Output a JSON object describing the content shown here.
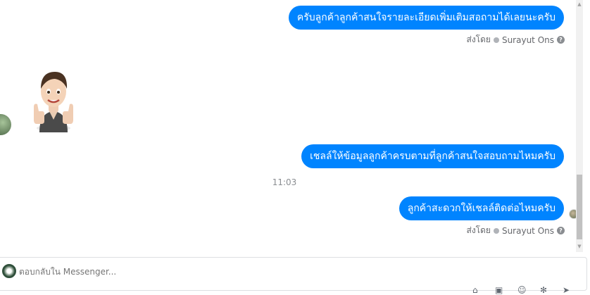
{
  "messages": [
    {
      "text": "ครับลูกค้าลูกค้าสนใจรายละเอียดเพิ่มเติมสอถามได้เลยนะครับ"
    },
    {
      "text": "เชลล์ให้ข้อมูลลูกค้าครบตามที่ลูกค้าสนใจสอบถามไหมครับ"
    },
    {
      "text": "ลูกค้าสะดวกให้เชลล์ติดต่อไหมครับ"
    }
  ],
  "sent_by": {
    "prefix": "ส่งโดย",
    "name": "Surayut Ons",
    "help_icon": "?"
  },
  "timestamp": "11:03",
  "sticker": {
    "name": "thumbs-up-avatar-sticker"
  },
  "composer": {
    "placeholder": "ตอบกลับใน Messenger..."
  },
  "colors": {
    "bubble": "#0084ff",
    "bubble_text": "#ffffff",
    "meta_text": "#65676b"
  }
}
